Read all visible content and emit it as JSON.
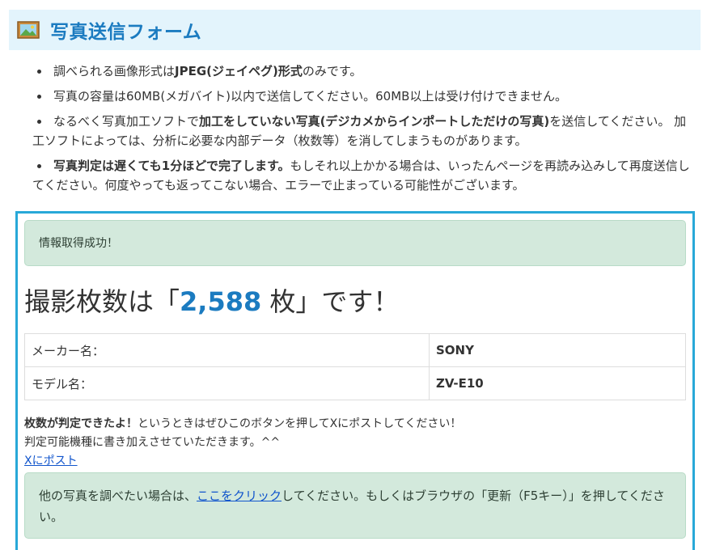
{
  "header": {
    "title": "写真送信フォーム",
    "icon": "picture-frame-icon"
  },
  "notes": {
    "n1": {
      "a": "調べられる画像形式は",
      "b": "JPEG(ジェイペグ)形式",
      "c": "のみです。"
    },
    "n2": {
      "a": "写真の容量は60MB(メガバイト)以内で送信してください。60MB以上は受け付けできません。"
    },
    "n3": {
      "a": "なるべく写真加工ソフトで",
      "b": "加工をしていない写真(デジカメからインポートしただけの写真)",
      "c": "を送信してください。 加工ソフトによっては、分析に必要な内部データ（枚数等）を消してしまうものがあります。"
    },
    "n4": {
      "b": "写真判定は遅くても1分ほどで完了します。",
      "c": "もしそれ以上かかる場合は、いったんページを再読み込みして再度送信してください。何度やっても返ってこない場合、エラーで止まっている可能性がございます。"
    }
  },
  "result": {
    "success_message": "情報取得成功！",
    "headline_prefix": "撮影枚数は「",
    "count": "2,588",
    "headline_suffix": " 枚」です！",
    "table": {
      "maker_label": "メーカー名：",
      "maker_value": "SONY",
      "model_label": "モデル名：",
      "model_value": "ZV-E10"
    },
    "post": {
      "bold": "枚数が判定できたよ！",
      "line1_rest": "というときはぜひこのボタンを押してXにポストしてください！",
      "line2": "判定可能機種に書き加えさせていただきます。^^",
      "link": "Xにポスト"
    },
    "retry": {
      "prefix": "他の写真を調べたい場合は、",
      "link": "ここをクリック",
      "suffix": "してください。もしくはブラウザの「更新（F5キー）」を押してください。"
    }
  },
  "colors": {
    "header_bg": "#e3f4fc",
    "accent_blue": "#1b7bc0",
    "result_border": "#28a8d8",
    "alert_bg": "#d3e9dc"
  }
}
